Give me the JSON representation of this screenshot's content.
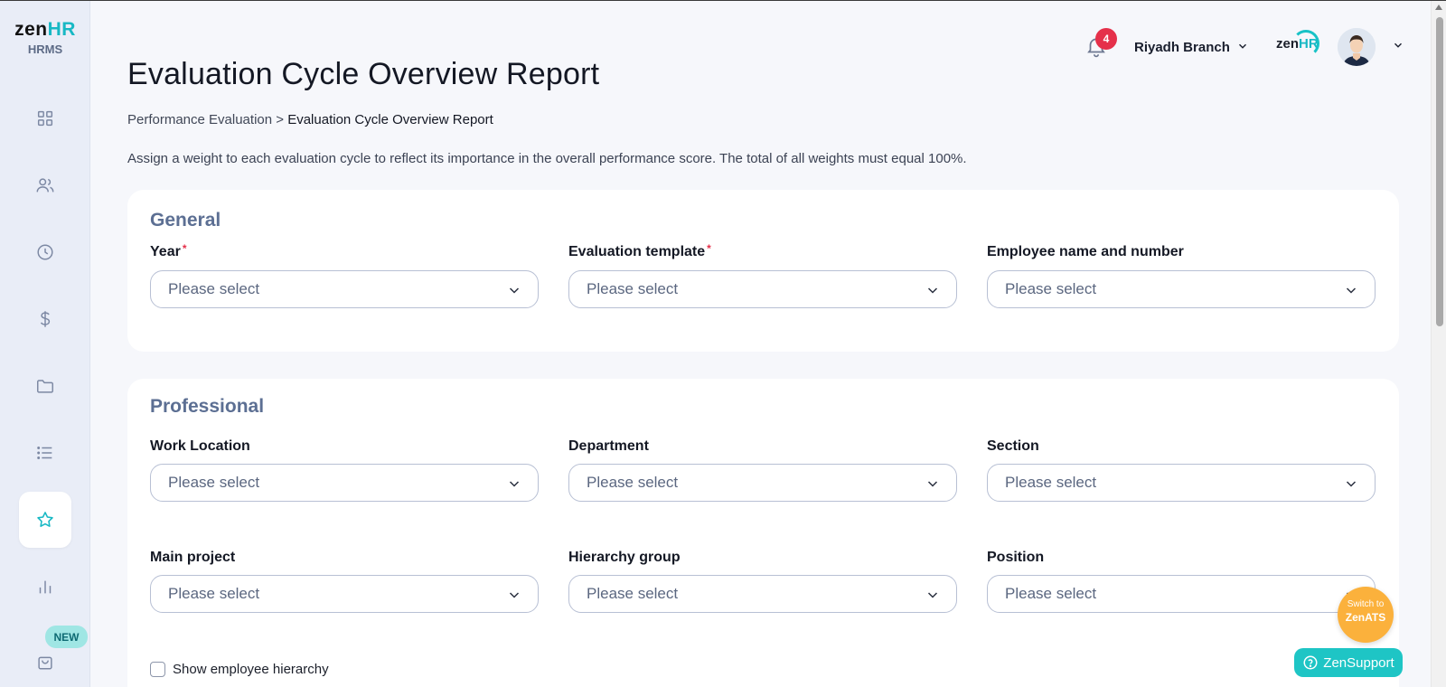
{
  "sidebar": {
    "logo_main": "zen",
    "logo_hr": "HR",
    "logo_sub": "HRMS",
    "items": [
      {
        "icon": "dashboard-icon"
      },
      {
        "icon": "users-icon"
      },
      {
        "icon": "clock-icon"
      },
      {
        "icon": "dollar-icon"
      },
      {
        "icon": "folder-icon"
      },
      {
        "icon": "list-icon"
      },
      {
        "icon": "star-icon",
        "active": true
      },
      {
        "icon": "bar-chart-icon"
      },
      {
        "icon": "shopping-bag-icon"
      }
    ],
    "new_badge": "NEW"
  },
  "header": {
    "notification_count": "4",
    "branch": "Riyadh Branch",
    "mini_logo_main": "zen",
    "mini_logo_hr": "HR"
  },
  "page": {
    "title": "Evaluation Cycle Overview Report",
    "breadcrumb_parent": "Performance Evaluation",
    "breadcrumb_sep": ">",
    "breadcrumb_current": "Evaluation Cycle Overview Report",
    "description": "Assign a weight to each evaluation cycle to reflect its importance in the overall performance score. The total of all weights must equal 100%."
  },
  "general": {
    "title": "General",
    "fields": [
      {
        "label": "Year",
        "required": "*",
        "placeholder": "Please select"
      },
      {
        "label": "Evaluation template",
        "required": "*",
        "placeholder": "Please select"
      },
      {
        "label": "Employee name and number",
        "placeholder": "Please select"
      }
    ]
  },
  "professional": {
    "title": "Professional",
    "fields": [
      {
        "label": "Work Location",
        "placeholder": "Please select"
      },
      {
        "label": "Department",
        "placeholder": "Please select"
      },
      {
        "label": "Section",
        "placeholder": "Please select"
      },
      {
        "label": "Main project",
        "placeholder": "Please select"
      },
      {
        "label": "Hierarchy group",
        "placeholder": "Please select"
      },
      {
        "label": "Position",
        "placeholder": "Please select"
      }
    ],
    "checkbox_label": "Show employee hierarchy"
  },
  "floating": {
    "zenats_line1": "Switch to",
    "zenats_line2": "ZenATS",
    "zensupport": "ZenSupport"
  },
  "colors": {
    "accent": "#17b8c4",
    "section_title": "#5c6f93",
    "badge": "#e5304a",
    "zenats": "#fbb13c",
    "zensupport": "#1ec5c5"
  }
}
